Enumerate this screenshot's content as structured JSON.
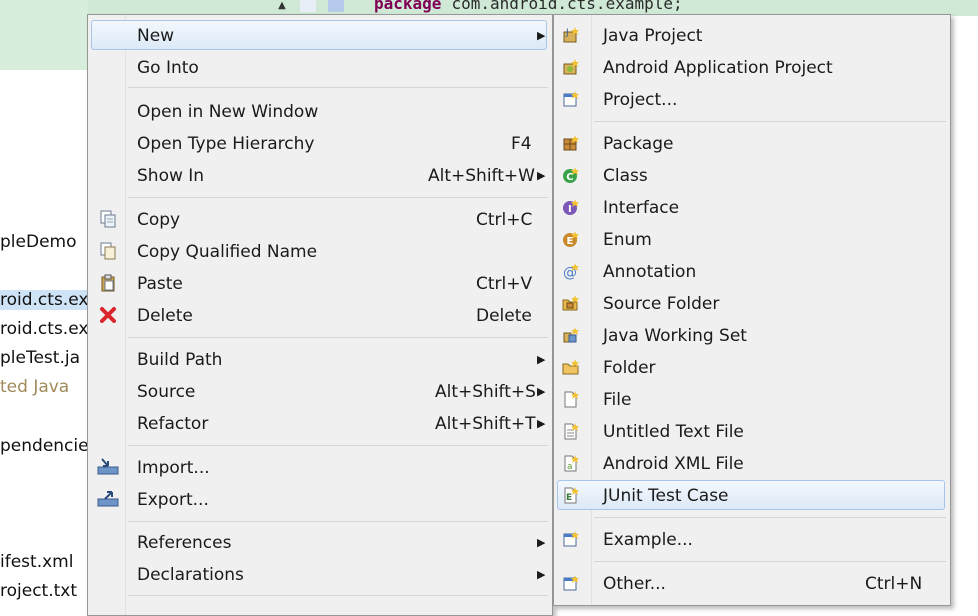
{
  "editor": {
    "code_keyword": "package",
    "code_rest": "com.android.cts.example;"
  },
  "explorer": {
    "items": [
      "pleDemo",
      "roid.cts.ex",
      "roid.cts.ex",
      "pleTest.ja",
      "ted Java",
      "pendencie",
      "ifest.xml",
      "roject.txt"
    ]
  },
  "context_menu": {
    "new": "New",
    "go_into": "Go Into",
    "open_new_window": "Open in New Window",
    "open_type_hierarchy": "Open Type Hierarchy",
    "open_type_hierarchy_shortcut": "F4",
    "show_in": "Show In",
    "show_in_shortcut": "Alt+Shift+W",
    "copy": "Copy",
    "copy_shortcut": "Ctrl+C",
    "copy_qualified": "Copy Qualified Name",
    "paste": "Paste",
    "paste_shortcut": "Ctrl+V",
    "delete": "Delete",
    "delete_shortcut": "Delete",
    "build_path": "Build Path",
    "source": "Source",
    "source_shortcut": "Alt+Shift+S",
    "refactor": "Refactor",
    "refactor_shortcut": "Alt+Shift+T",
    "import": "Import...",
    "export": "Export...",
    "references": "References",
    "declarations": "Declarations"
  },
  "new_submenu": {
    "java_project": "Java Project",
    "android_app_project": "Android Application Project",
    "project": "Project...",
    "package": "Package",
    "class": "Class",
    "interface": "Interface",
    "enum": "Enum",
    "annotation": "Annotation",
    "source_folder": "Source Folder",
    "java_working_set": "Java Working Set",
    "folder": "Folder",
    "file": "File",
    "untitled_text_file": "Untitled Text File",
    "android_xml_file": "Android XML File",
    "junit_test_case": "JUnit Test Case",
    "example": "Example...",
    "other": "Other...",
    "other_shortcut": "Ctrl+N"
  },
  "colors": {
    "hover_border": "#a8c5ea",
    "menu_bg": "#f0f0f0",
    "delete_icon": "#d9262c",
    "class_icon": "#3aa34a",
    "interface_icon": "#7d58b8",
    "enum_icon": "#c88a2a"
  }
}
